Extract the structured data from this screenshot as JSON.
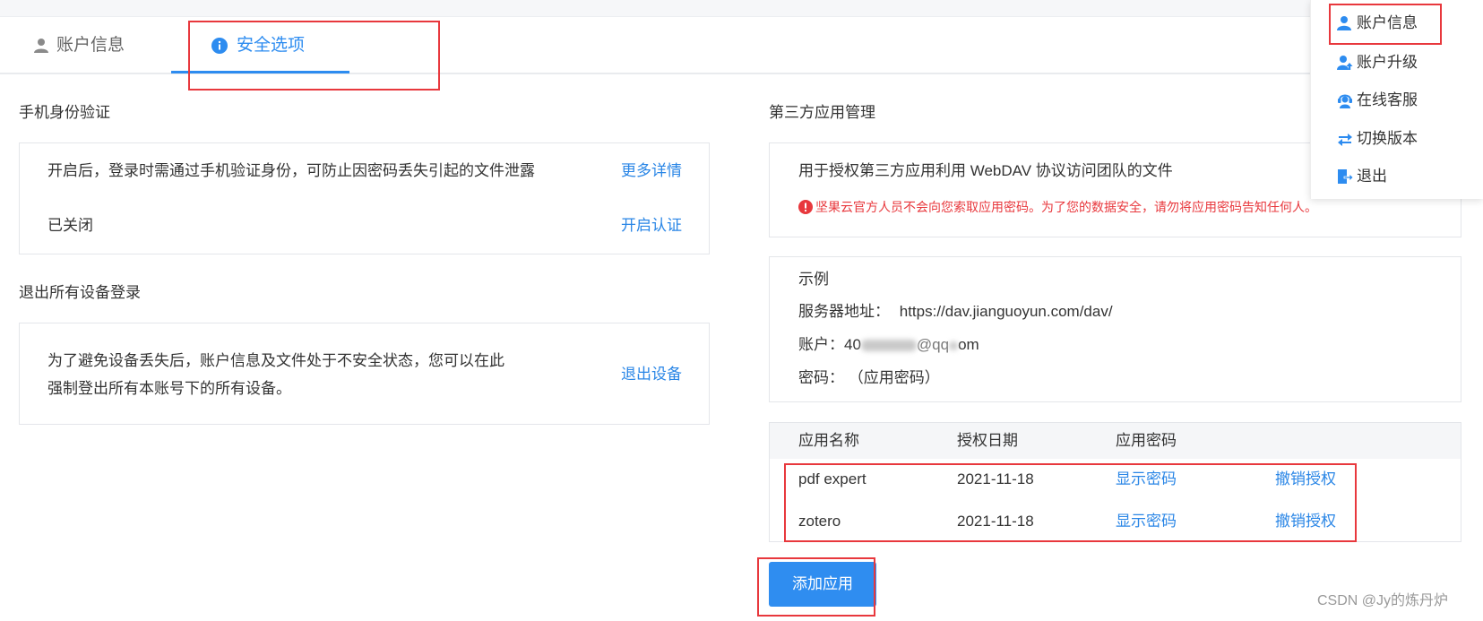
{
  "tabs": [
    {
      "label": "账户信息",
      "icon": "person-icon",
      "active": false
    },
    {
      "label": "安全选项",
      "icon": "info-icon",
      "active": true
    }
  ],
  "phone_verify": {
    "title": "手机身份验证",
    "description": "开启后，登录时需通过手机验证身份，可防止因密码丢失引起的文件泄露",
    "more_link": "更多详情",
    "status": "已关闭",
    "enable_link": "开启认证"
  },
  "logout_devices": {
    "title": "退出所有设备登录",
    "description_line1": "为了避免设备丢失后，账户信息及文件处于不安全状态，您可以在此",
    "description_line2": "强制登出所有本账号下的所有设备。",
    "action_link": "退出设备"
  },
  "third_party": {
    "title": "第三方应用管理",
    "description": "用于授权第三方应用利用 WebDAV 协议访问团队的文件",
    "warning": "坚果云官方人员不会向您索取应用密码。为了您的数据安全，请勿将应用密码告知任何人。"
  },
  "example": {
    "title": "示例",
    "server_label": "服务器地址：",
    "server_value": "https://dav.jianguoyun.com/dav/",
    "account_label": "账户：",
    "account_visible_start": "40",
    "account_visible_mid": "@qq",
    "account_visible_end": "om",
    "password_label": "密码：",
    "password_value": "（应用密码）"
  },
  "apps_table": {
    "columns": [
      "应用名称",
      "授权日期",
      "应用密码"
    ],
    "rows": [
      {
        "name": "pdf expert",
        "date": "2021-11-18",
        "show_password": "显示密码",
        "revoke": "撤销授权"
      },
      {
        "name": "zotero",
        "date": "2021-11-18",
        "show_password": "显示密码",
        "revoke": "撤销授权"
      }
    ]
  },
  "add_app_button": "添加应用",
  "user_menu": {
    "items": [
      {
        "label": "账户信息",
        "icon": "user-icon"
      },
      {
        "label": "账户升级",
        "icon": "user-upgrade-icon"
      },
      {
        "label": "在线客服",
        "icon": "customer-service-icon"
      },
      {
        "label": "切换版本",
        "icon": "switch-icon"
      },
      {
        "label": "退出",
        "icon": "logout-icon"
      }
    ]
  },
  "watermark": "CSDN @Jy的炼丹炉",
  "colors": {
    "accent": "#2d8cf0",
    "link": "#2a86e6",
    "warning": "#e8383d",
    "annotation_box": "#e8383d",
    "watermark": "#9a9a9a"
  }
}
